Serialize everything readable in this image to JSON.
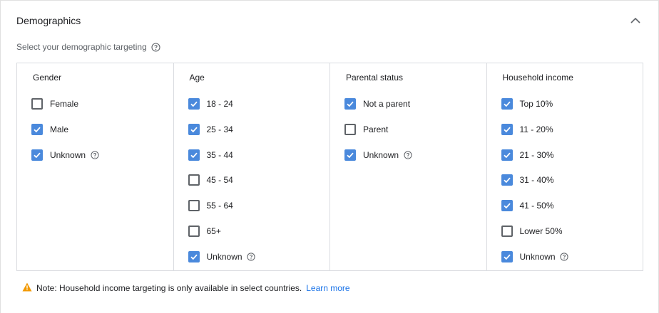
{
  "header": {
    "title": "Demographics"
  },
  "subtitle": "Select your demographic targeting",
  "colors": {
    "checkbox_checked": "#4a89dc",
    "warning": "#f29900",
    "link": "#1a73e8"
  },
  "columns": [
    {
      "title": "Gender",
      "options": [
        {
          "label": "Female",
          "checked": false,
          "help": false
        },
        {
          "label": "Male",
          "checked": true,
          "help": false
        },
        {
          "label": "Unknown",
          "checked": true,
          "help": true
        }
      ]
    },
    {
      "title": "Age",
      "options": [
        {
          "label": "18 - 24",
          "checked": true,
          "help": false
        },
        {
          "label": "25 - 34",
          "checked": true,
          "help": false
        },
        {
          "label": "35 - 44",
          "checked": true,
          "help": false
        },
        {
          "label": "45 - 54",
          "checked": false,
          "help": false
        },
        {
          "label": "55 - 64",
          "checked": false,
          "help": false
        },
        {
          "label": "65+",
          "checked": false,
          "help": false
        },
        {
          "label": "Unknown",
          "checked": true,
          "help": true
        }
      ]
    },
    {
      "title": "Parental status",
      "options": [
        {
          "label": "Not a parent",
          "checked": true,
          "help": false
        },
        {
          "label": "Parent",
          "checked": false,
          "help": false
        },
        {
          "label": "Unknown",
          "checked": true,
          "help": true
        }
      ]
    },
    {
      "title": "Household income",
      "options": [
        {
          "label": "Top 10%",
          "checked": true,
          "help": false
        },
        {
          "label": "11 - 20%",
          "checked": true,
          "help": false
        },
        {
          "label": "21 - 30%",
          "checked": true,
          "help": false
        },
        {
          "label": "31 - 40%",
          "checked": true,
          "help": false
        },
        {
          "label": "41 - 50%",
          "checked": true,
          "help": false
        },
        {
          "label": "Lower 50%",
          "checked": false,
          "help": false
        },
        {
          "label": "Unknown",
          "checked": true,
          "help": true
        }
      ]
    }
  ],
  "note": {
    "text": "Note: Household income targeting is only available in select countries.",
    "link": "Learn more"
  }
}
